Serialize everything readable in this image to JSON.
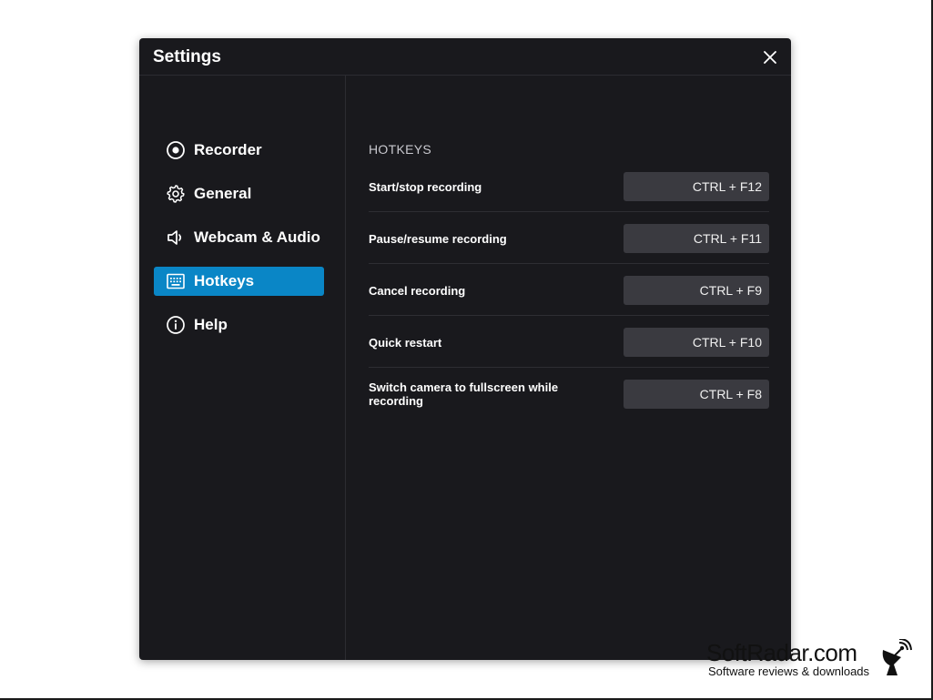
{
  "window": {
    "title": "Settings"
  },
  "sidebar": {
    "items": [
      {
        "label": "Recorder",
        "icon": "record-icon",
        "active": false
      },
      {
        "label": "General",
        "icon": "gear-icon",
        "active": false
      },
      {
        "label": "Webcam & Audio",
        "icon": "speaker-icon",
        "active": false
      },
      {
        "label": "Hotkeys",
        "icon": "keyboard-icon",
        "active": true
      },
      {
        "label": "Help",
        "icon": "info-icon",
        "active": false
      }
    ]
  },
  "hotkeys": {
    "section_title": "HOTKEYS",
    "rows": [
      {
        "label": "Start/stop recording",
        "value": "CTRL + F12"
      },
      {
        "label": "Pause/resume recording",
        "value": "CTRL + F11"
      },
      {
        "label": "Cancel recording",
        "value": "CTRL + F9"
      },
      {
        "label": "Quick restart",
        "value": "CTRL + F10"
      },
      {
        "label": "Switch camera to fullscreen while recording",
        "value": "CTRL + F8"
      }
    ]
  },
  "watermark": {
    "brand": "SoftRadar.com",
    "tagline": "Software reviews & downloads"
  },
  "colors": {
    "window_bg": "#19191d",
    "accent": "#0a86c6",
    "field_bg": "#3a3a40"
  }
}
